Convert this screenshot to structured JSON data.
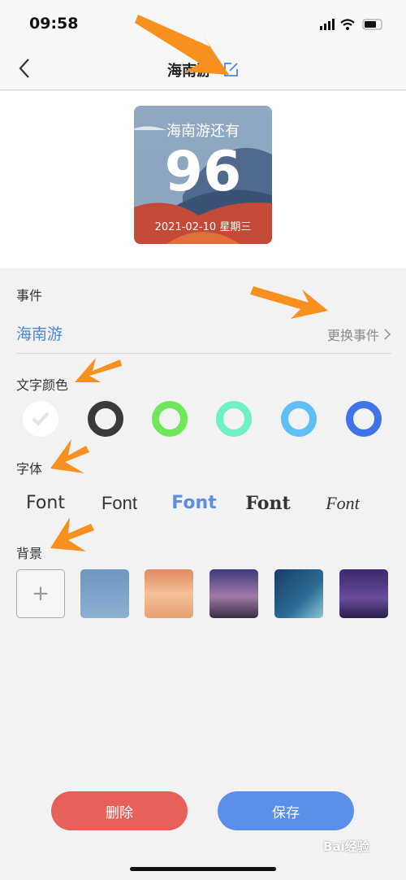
{
  "status": {
    "time": "09:58"
  },
  "nav": {
    "title": "海南游",
    "back_icon": "chevron-left-icon",
    "edit_icon": "edit-icon"
  },
  "card": {
    "caption": "海南游还有",
    "days": "96",
    "date": "2021-02-10 星期三"
  },
  "event": {
    "label": "事件",
    "value": "海南游",
    "change": "更换事件",
    "change_icon": "chevron-right-icon"
  },
  "text_color": {
    "label": "文字颜色",
    "colors": [
      "#ffffff",
      "#3a3a3a",
      "#6ee85a",
      "#6ef0c8",
      "#5ec0f5",
      "#3f74e8"
    ],
    "selected": 0
  },
  "font": {
    "label": "字体",
    "options": [
      "Font",
      "Font",
      "Font",
      "Font",
      "Font"
    ],
    "selected": 2,
    "accent": "#5b8ee8"
  },
  "background": {
    "label": "背景",
    "add": "+"
  },
  "actions": {
    "delete": "删除",
    "save": "保存",
    "delete_color": "#e8605a",
    "save_color": "#5b8ee8"
  },
  "watermark": "Bai经验"
}
